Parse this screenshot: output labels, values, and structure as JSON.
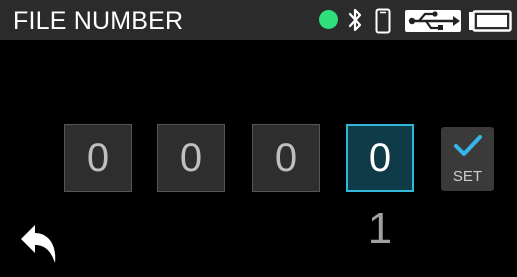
{
  "header": {
    "title": "FILE NUMBER",
    "icons": [
      "status-led-icon",
      "bluetooth-icon",
      "phone-icon",
      "usb-icon",
      "battery-icon"
    ],
    "status_led_color": "#2ee07a"
  },
  "digits": [
    "0",
    "0",
    "0",
    "0"
  ],
  "active_digit_index": 3,
  "set_button": {
    "label": "SET",
    "icon": "checkmark-icon",
    "check_color": "#34b6e8"
  },
  "file_number": "1",
  "back_button": {
    "icon": "back-arrow-icon"
  },
  "colors": {
    "header_bg": "#2b2b2b",
    "active_digit_border": "#2fb8d8",
    "active_digit_bg": "#0f3a48"
  }
}
